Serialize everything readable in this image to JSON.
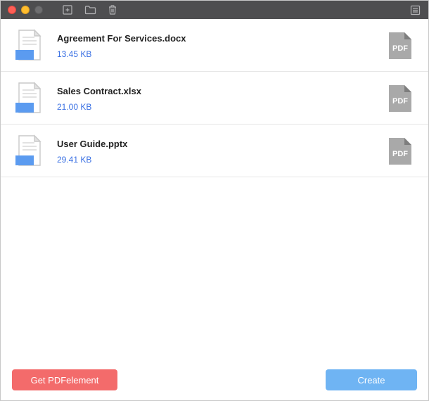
{
  "colors": {
    "accent_link": "#3a70e3",
    "btn_primary": "#f36b6b",
    "btn_secondary": "#6fb4f3",
    "titlebar": "#4e4e50"
  },
  "files": [
    {
      "name": "Agreement For Services.docx",
      "size": "13.45 KB"
    },
    {
      "name": "Sales Contract.xlsx",
      "size": "21.00 KB"
    },
    {
      "name": "User Guide.pptx",
      "size": "29.41 KB"
    }
  ],
  "buttons": {
    "get_pdfelement": "Get PDFelement",
    "create": "Create"
  },
  "pdf_badge_label": "PDF"
}
